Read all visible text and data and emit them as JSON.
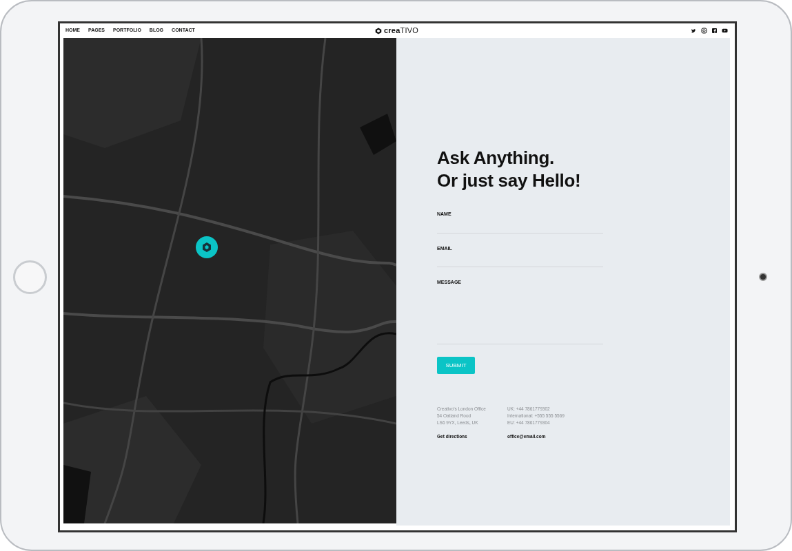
{
  "nav": {
    "links": [
      {
        "label": "HOME"
      },
      {
        "label": "PAGES"
      },
      {
        "label": "PORTFOLIO"
      },
      {
        "label": "BLOG"
      },
      {
        "label": "CONTACT"
      }
    ],
    "logo": "**crea**TIVO",
    "social": [
      {
        "kind": "twitter"
      },
      {
        "kind": "instagram"
      },
      {
        "kind": "facebook"
      },
      {
        "kind": "youtube"
      }
    ]
  },
  "contact_form": {
    "heading": [
      "Ask Anything.",
      "Or just say Hello!"
    ],
    "fields": [
      {
        "label": "NAME",
        "kind": "input"
      },
      {
        "label": "EMAIL",
        "kind": "input"
      },
      {
        "label": "MESSAGE",
        "kind": "textarea"
      }
    ],
    "submit": "SUBMIT"
  },
  "info": [
    {
      "lines": [
        "Creativo's London Office",
        "54 Oatland Rood",
        "LS6 9YX, Leeds, UK"
      ],
      "link": "Get directions"
    },
    {
      "lines": [
        "UK: +44 7861779302",
        "International: +555 555 5569",
        "EU: +44 7861779304"
      ],
      "link": "office@email.com"
    }
  ]
}
